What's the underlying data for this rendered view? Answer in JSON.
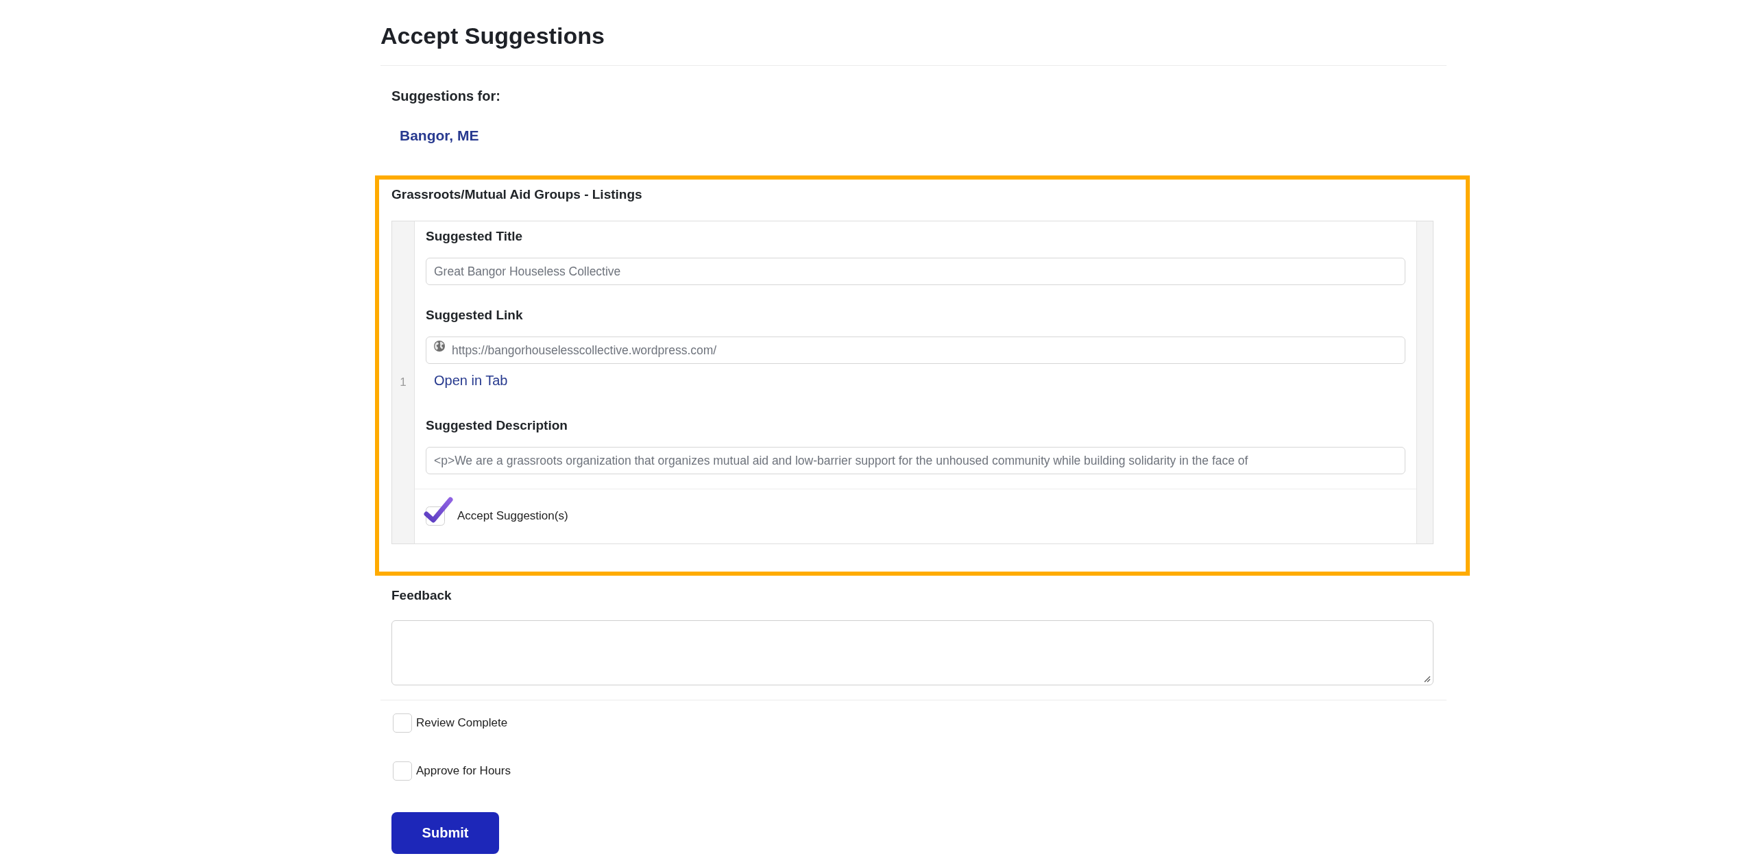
{
  "page": {
    "title": "Accept Suggestions"
  },
  "suggestions_for": {
    "label": "Suggestions for:",
    "location": "Bangor, ME"
  },
  "section": {
    "title": "Grassroots/Mutual Aid Groups - Listings",
    "highlighted": true,
    "rows": [
      {
        "number": "1",
        "fields": [
          {
            "kind": "text",
            "label": "Suggested Title",
            "value": "Great Bangor Houseless Collective"
          },
          {
            "kind": "link",
            "label": "Suggested Link",
            "value": "https://bangorhouselesscollective.wordpress.com/",
            "action": "Open in Tab"
          },
          {
            "kind": "text",
            "label": "Suggested Description",
            "value": "<p>We are a grassroots organization that organizes mutual aid and low-barrier support for the unhoused community while building solidarity in the face of"
          }
        ],
        "accept": {
          "label": "Accept Suggestion(s)",
          "checked": true
        }
      }
    ]
  },
  "feedback": {
    "label": "Feedback"
  },
  "checkboxes": [
    {
      "label": "Review Complete",
      "checked": false
    },
    {
      "label": "Approve for Hours",
      "checked": false
    }
  ],
  "submit": {
    "label": "Submit"
  }
}
